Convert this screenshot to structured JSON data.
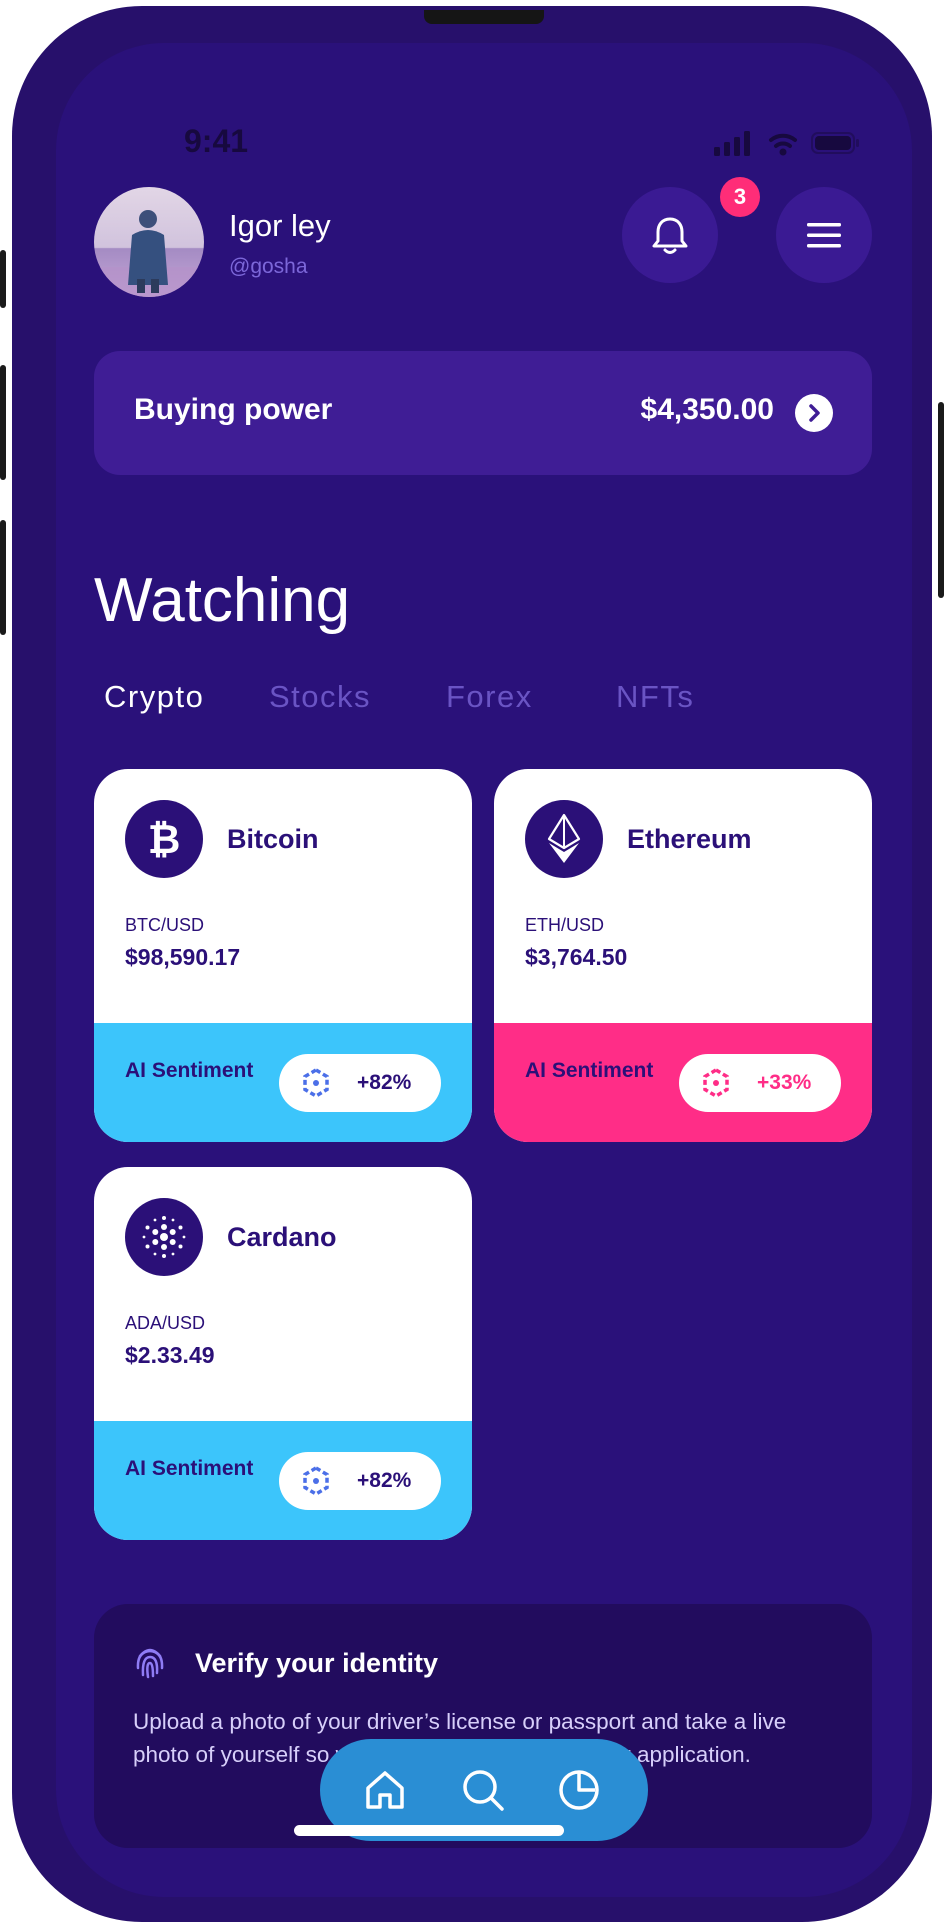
{
  "status": {
    "time": "9:41"
  },
  "user": {
    "name": "Igor ley",
    "handle": "@gosha"
  },
  "notifications": {
    "count": "3"
  },
  "buying_power": {
    "label": "Buying power",
    "value": "$4,350.00"
  },
  "watching": {
    "title": "Watching",
    "tabs": [
      {
        "label": "Crypto",
        "active": true
      },
      {
        "label": "Stocks",
        "active": false
      },
      {
        "label": "Forex",
        "active": false
      },
      {
        "label": "NFTs",
        "active": false
      }
    ]
  },
  "cards": [
    {
      "name": "Bitcoin",
      "icon": "bitcoin-icon",
      "pair": "BTC/USD",
      "price": "$98,590.17",
      "sentiment_label": "AI Sentiment",
      "sentiment_value": "+82%",
      "sentiment_color": "#3cc5fb"
    },
    {
      "name": "Ethereum",
      "icon": "ethereum-icon",
      "pair": "ETH/USD",
      "price": "$3,764.50",
      "sentiment_label": "AI Sentiment",
      "sentiment_value": "+33%",
      "sentiment_color": "#ff2d87"
    },
    {
      "name": "Cardano",
      "icon": "cardano-icon",
      "pair": "ADA/USD",
      "price": "$2.33.49",
      "sentiment_label": "AI Sentiment",
      "sentiment_value": "+82%",
      "sentiment_color": "#3cc5fb"
    }
  ],
  "verify": {
    "title": "Verify your identity",
    "text": "Upload a photo of your driver’s license or passport and take a live photo of yourself so we can finish processing your application."
  },
  "nav": {
    "items": [
      "home-icon",
      "search-icon",
      "portfolio-chart-icon"
    ]
  },
  "colors": {
    "background": "#2a117a",
    "card_text": "#2b1078",
    "accent_blue": "#3cc5fb",
    "accent_pink": "#ff2d87",
    "nav_bg": "#2a8ed4"
  }
}
